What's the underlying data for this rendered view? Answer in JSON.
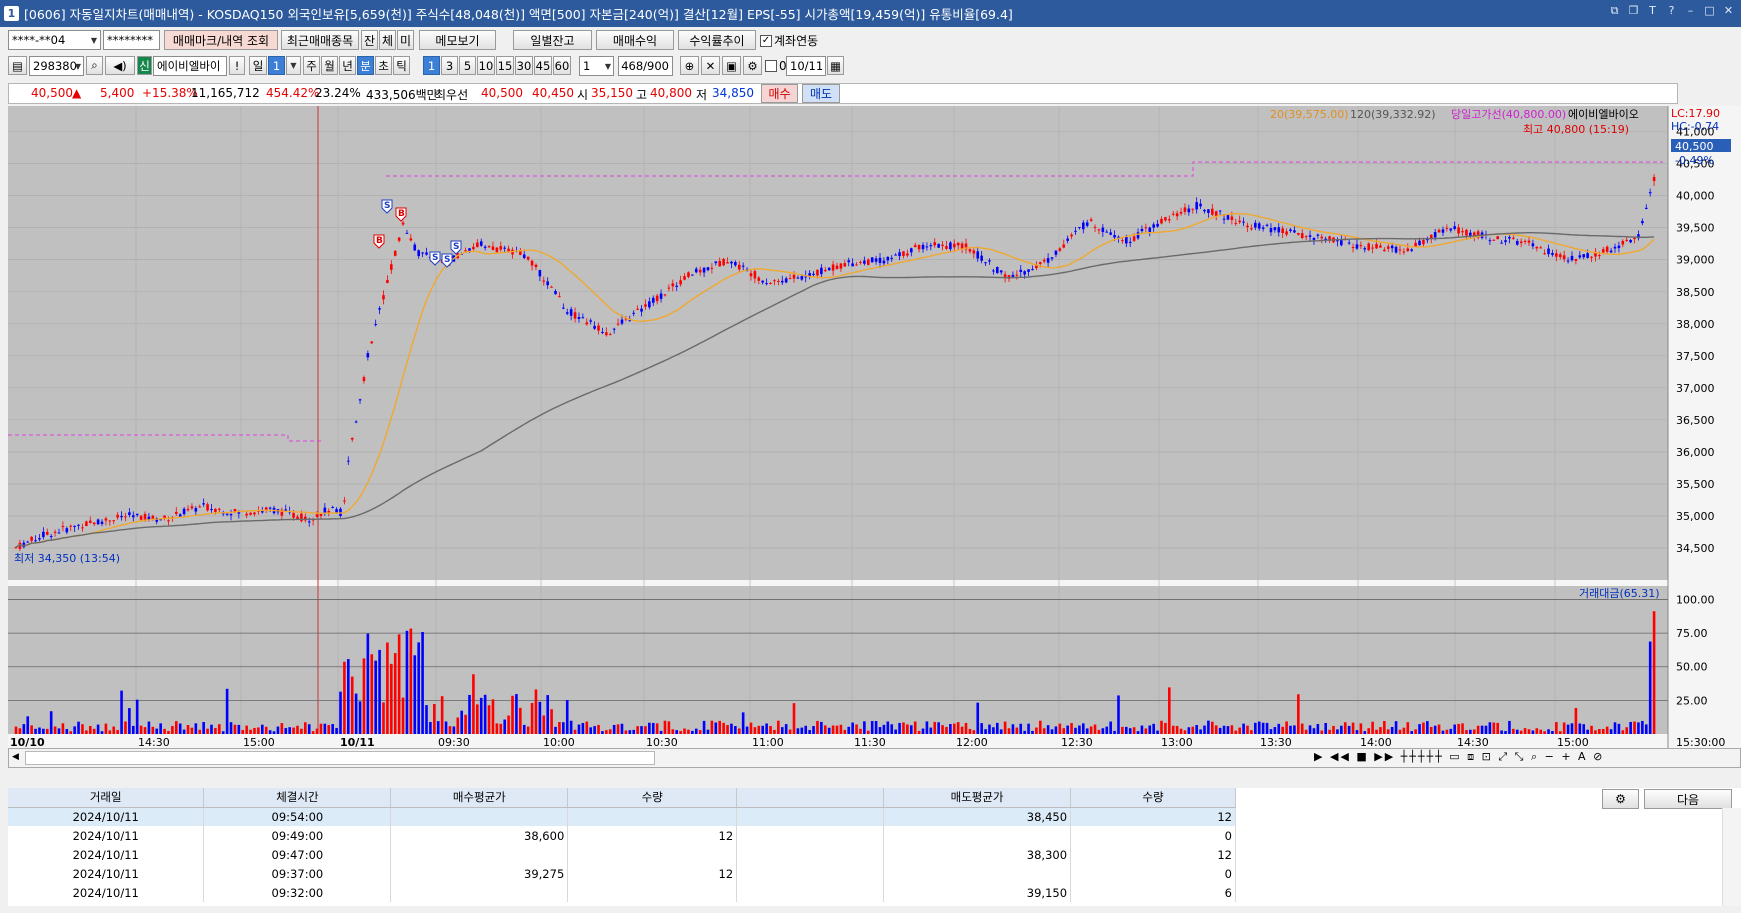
{
  "title": {
    "app_no": "1",
    "text": "[0606] 자동일지차트(매매내역) - KOSDAQ150 외국인보유[5,659(천)] 주식수[48,048(천)] 액면[500] 자본금[240(억)] 결산[12월] EPS[-55] 시가총액[19,459(억)] 유통비율[69.4]"
  },
  "toolbar1": {
    "account": "****-**04",
    "password": "********",
    "inquiry_btn": "매매마크/내역 조회",
    "recent_btn": "최근매매종목",
    "tab1": "잔",
    "tab2": "체",
    "tab3": "미",
    "memo_btn": "메모보기",
    "daily_btn": "일별잔고",
    "profit_btn": "매매수익",
    "rate_btn": "수익률추이",
    "link_label": "계좌연동",
    "link_checked": true
  },
  "toolbar2": {
    "code": "298380",
    "credit": "신",
    "name": "에이비엘바이",
    "alert": "!",
    "period_day": "일",
    "period_n": "1",
    "periods": [
      "주",
      "월",
      "년",
      "분",
      "초",
      "틱"
    ],
    "active_period": "분",
    "intervals": [
      "1",
      "3",
      "5",
      "10",
      "15",
      "30",
      "45",
      "60"
    ],
    "active_interval": "1",
    "count_value": "1",
    "count": "468",
    "count_total": "/900",
    "date_flag": "0",
    "date": "10/11"
  },
  "quote": {
    "price": "40,500",
    "arrow": "▲",
    "change": "5,400",
    "change_pct": "+15.38%",
    "volume": "11,165,712",
    "vol_ratio": "454.42%",
    "turnover": "23.24%",
    "amount": "433,506백만",
    "best_label": "최우선",
    "ask": "40,500",
    "bid": "40,450",
    "open_label": "시",
    "open": "35,150",
    "high_label": "고",
    "high": "40,800",
    "low_label": "저",
    "low": "34,850",
    "buy_btn": "매수",
    "sell_btn": "매도"
  },
  "chart": {
    "legend_ma20": "20(39,575.00)",
    "legend_ma120": "120(39,332.92)",
    "legend_limit": "당일고가선(40,800.00)",
    "legend_name": "에이비엘바이오",
    "lc": "LC:17.90",
    "hc": "HC:-0.74",
    "high_note": "최고 40,800 (15:19)",
    "low_note": "최저 34,350 (13:54)",
    "price_tag": "40,500",
    "price_tag_pct": "-0.49%",
    "vol_legend": "거래대금(65.31)",
    "colors": {
      "up": "#ff0000",
      "down": "#0000ff",
      "ma20": "#f0a830",
      "ma120": "#6a6a6a",
      "limit": "#e040e0",
      "bg": "#c0c0c0"
    }
  },
  "chart_data": {
    "type": "candlestick",
    "y_ticks": [
      "41,000",
      "40,500",
      "40,000",
      "39,500",
      "39,000",
      "38,500",
      "38,000",
      "37,500",
      "37,000",
      "36,500",
      "36,000",
      "35,500",
      "35,000",
      "34,500"
    ],
    "vol_ticks": [
      "100.00",
      "75.00",
      "50.00",
      "25.00"
    ],
    "x_ticks": [
      "10/10",
      "14:30",
      "15:00",
      "10/11",
      "09:30",
      "10:00",
      "10:30",
      "11:00",
      "11:30",
      "12:00",
      "12:30",
      "13:00",
      "13:30",
      "14:00",
      "14:30",
      "15:00",
      "15:30:00"
    ],
    "ylim": [
      34000,
      41400
    ],
    "markers": [
      "S",
      "B",
      "B",
      "S",
      "S",
      "S"
    ]
  },
  "table": {
    "headers": [
      "거래일",
      "체결시간",
      "매수평균가",
      "수량",
      "",
      "매도평균가",
      "수량"
    ],
    "rows": [
      [
        "2024/10/11",
        "09:54:00",
        "",
        "",
        "",
        "38,450",
        "12"
      ],
      [
        "2024/10/11",
        "09:49:00",
        "38,600",
        "12",
        "",
        "",
        "0"
      ],
      [
        "2024/10/11",
        "09:47:00",
        "",
        "",
        "",
        "38,300",
        "12"
      ],
      [
        "2024/10/11",
        "09:37:00",
        "39,275",
        "12",
        "",
        "",
        "0"
      ],
      [
        "2024/10/11",
        "09:32:00",
        "",
        "",
        "",
        "39,150",
        "6"
      ]
    ],
    "next_btn": "다음"
  }
}
